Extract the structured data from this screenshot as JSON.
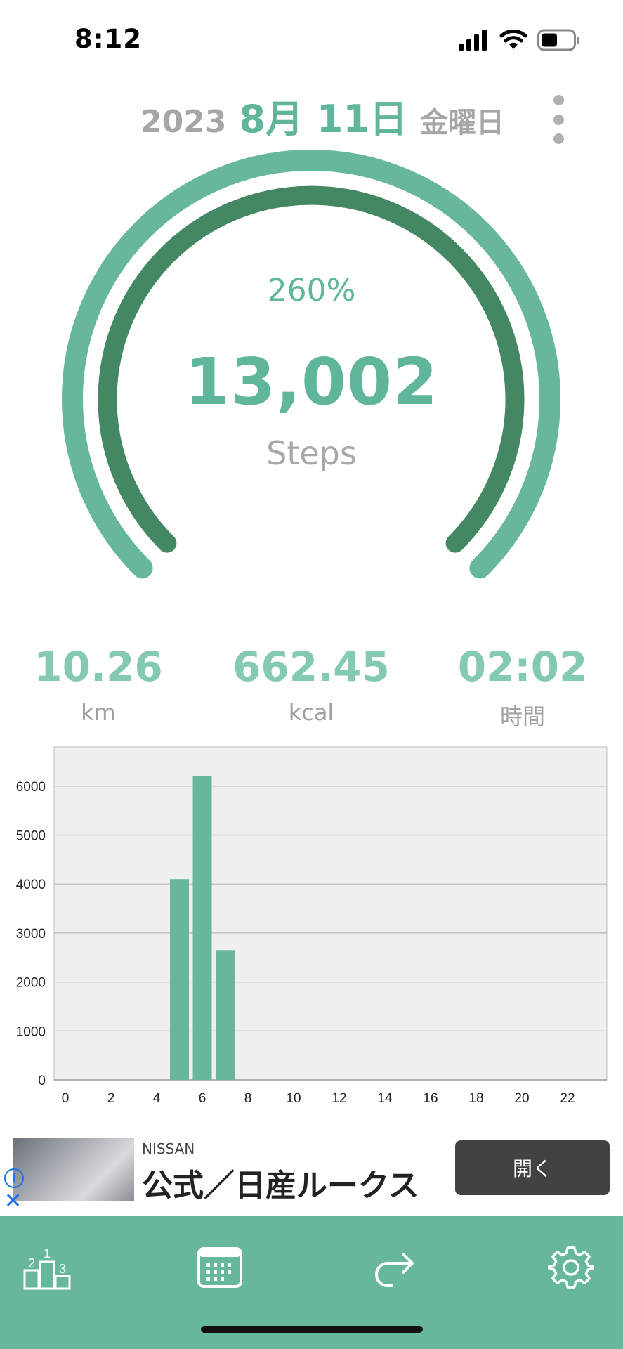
{
  "status_bar": {
    "time": "8:12"
  },
  "header": {
    "year": "2023",
    "month_day": "8月 11日",
    "weekday": "金曜日"
  },
  "gauge": {
    "percent": "260%",
    "steps": "13,002",
    "steps_label": "Steps",
    "outer_color": "#67b79c",
    "inner_color": "#438763"
  },
  "stats": {
    "distance": {
      "value": "10.26",
      "unit": "km"
    },
    "calories": {
      "value": "662.45",
      "unit": "kcal"
    },
    "duration": {
      "value": "02:02",
      "unit": "時間"
    }
  },
  "chart_data": {
    "type": "bar",
    "x": [
      0,
      1,
      2,
      3,
      4,
      5,
      6,
      7,
      8,
      9,
      10,
      11,
      12,
      13,
      14,
      15,
      16,
      17,
      18,
      19,
      20,
      21,
      22,
      23
    ],
    "values": [
      0,
      0,
      0,
      0,
      0,
      4100,
      6200,
      2650,
      0,
      0,
      0,
      0,
      0,
      0,
      0,
      0,
      0,
      0,
      0,
      0,
      0,
      0,
      0,
      0
    ],
    "x_ticks": [
      "0",
      "2",
      "4",
      "6",
      "8",
      "10",
      "12",
      "14",
      "16",
      "18",
      "20",
      "22"
    ],
    "y_ticks": [
      "0",
      "1000",
      "2000",
      "3000",
      "4000",
      "5000",
      "6000"
    ],
    "ylim": [
      0,
      6800
    ],
    "grid": true,
    "bar_color": "#67b79c",
    "plot_background": "#efefef"
  },
  "ad": {
    "brand": "NISSAN",
    "title": "公式／日産ルークス",
    "button": "開く"
  },
  "bottom_nav": {
    "items": [
      {
        "icon": "ranking-podium-icon"
      },
      {
        "icon": "calendar-icon"
      },
      {
        "icon": "share-arrow-icon"
      },
      {
        "icon": "gear-icon"
      }
    ]
  }
}
